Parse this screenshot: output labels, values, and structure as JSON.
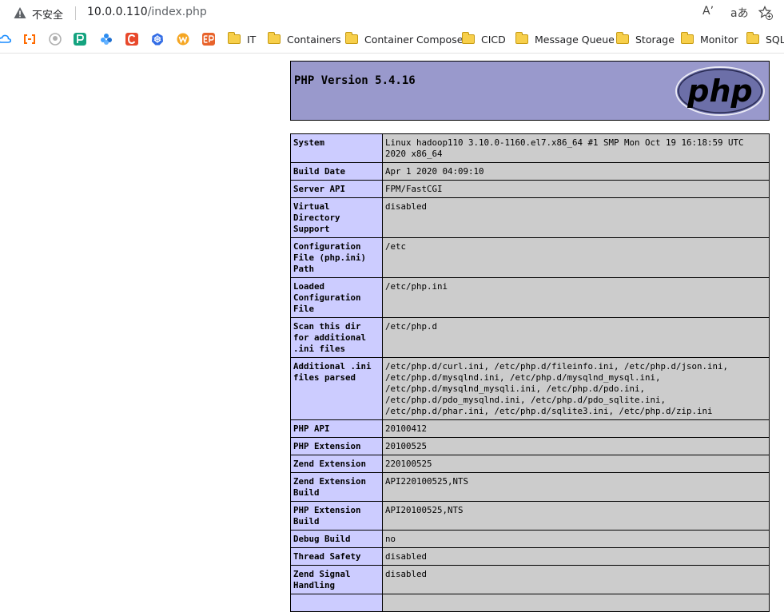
{
  "browser": {
    "security_label": "不安全",
    "url_host": "10.0.0.110",
    "url_path": "/index.php",
    "read_aloud_glyph": "Aʼ",
    "translate_glyph": "aあ"
  },
  "bookmarks": {
    "apps": [
      {
        "icon": "cloud-icon",
        "color": "#1a8cff"
      },
      {
        "icon": "code-bracket-icon",
        "color": "#ff6a00"
      },
      {
        "icon": "github-icon",
        "color": "#444444"
      },
      {
        "icon": "p-app-icon",
        "color": "#14a37f"
      },
      {
        "icon": "flower-app-icon",
        "color": "#2d8cf0"
      },
      {
        "icon": "c-app-icon",
        "color": "#e8482b"
      },
      {
        "icon": "kubernetes-icon",
        "color": "#326ce5"
      },
      {
        "icon": "w-app-icon",
        "color": "#f5a623"
      },
      {
        "icon": "ep-app-icon",
        "color": "#e8632b"
      }
    ],
    "folders": [
      "IT",
      "Containers",
      "Container Compose",
      "CICD",
      "Message Queue",
      "Storage",
      "Monitor",
      "SQL"
    ]
  },
  "php": {
    "title": "PHP Version 5.4.16",
    "logo_text": "php",
    "rows": [
      {
        "key": "System",
        "value": "Linux hadoop110 3.10.0-1160.el7.x86_64 #1 SMP Mon Oct 19 16:18:59 UTC 2020 x86_64"
      },
      {
        "key": "Build Date",
        "value": "Apr 1 2020 04:09:10"
      },
      {
        "key": "Server API",
        "value": "FPM/FastCGI"
      },
      {
        "key": "Virtual Directory Support",
        "value": "disabled"
      },
      {
        "key": "Configuration File (php.ini) Path",
        "value": "/etc"
      },
      {
        "key": "Loaded Configuration File",
        "value": "/etc/php.ini"
      },
      {
        "key": "Scan this dir for additional .ini files",
        "value": "/etc/php.d"
      },
      {
        "key": "Additional .ini files parsed",
        "value": "/etc/php.d/curl.ini, /etc/php.d/fileinfo.ini, /etc/php.d/json.ini, /etc/php.d/mysqlnd.ini, /etc/php.d/mysqlnd_mysql.ini, /etc/php.d/mysqlnd_mysqli.ini, /etc/php.d/pdo.ini, /etc/php.d/pdo_mysqlnd.ini, /etc/php.d/pdo_sqlite.ini, /etc/php.d/phar.ini, /etc/php.d/sqlite3.ini, /etc/php.d/zip.ini"
      },
      {
        "key": "PHP API",
        "value": "20100412"
      },
      {
        "key": "PHP Extension",
        "value": "20100525"
      },
      {
        "key": "Zend Extension",
        "value": "220100525"
      },
      {
        "key": "Zend Extension Build",
        "value": "API220100525,NTS"
      },
      {
        "key": "PHP Extension Build",
        "value": "API20100525,NTS"
      },
      {
        "key": "Debug Build",
        "value": "no"
      },
      {
        "key": "Thread Safety",
        "value": "disabled"
      },
      {
        "key": "Zend Signal Handling",
        "value": "disabled"
      },
      {
        "key": "",
        "value": ""
      }
    ]
  }
}
